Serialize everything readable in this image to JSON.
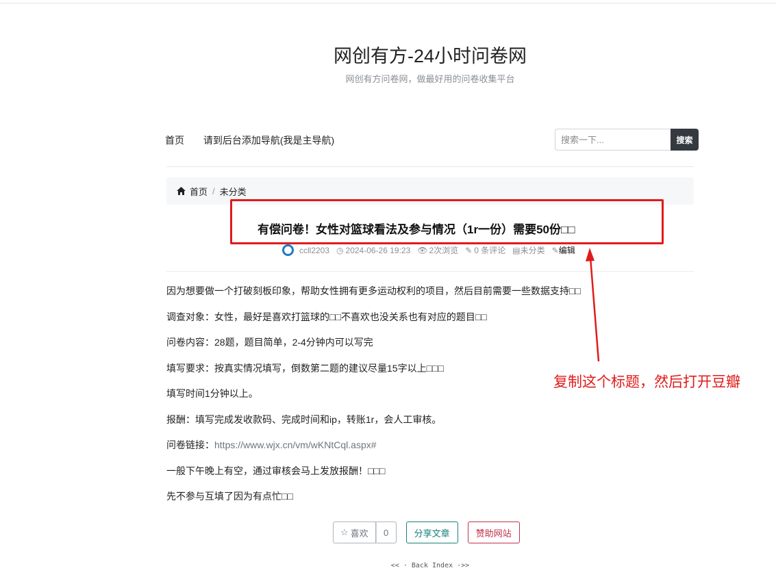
{
  "site": {
    "title": "网创有方-24小时问卷网",
    "subtitle": "网创有方问卷网，做最好用的问卷收集平台"
  },
  "nav": {
    "items": [
      "首页",
      "请到后台添加导航(我是主导航)"
    ]
  },
  "search": {
    "placeholder": "搜索一下...",
    "button_label": "搜索"
  },
  "breadcrumb": {
    "home_label": "首页",
    "separator": "/",
    "category": "未分类"
  },
  "post": {
    "title": "有偿问卷！女性对篮球看法及参与情况（1r一份）需要50份□□",
    "author": "ccll2203",
    "datetime": "2024-06-26 19:23",
    "views": "2次浏览",
    "comments": "0 条评论",
    "category": "未分类",
    "edit_label": "编辑"
  },
  "content": {
    "paragraphs": [
      "因为想要做一个打破刻板印象，帮助女性拥有更多运动权利的项目，然后目前需要一些数据支持□□",
      "调查对象：女性，最好是喜欢打篮球的□□不喜欢也没关系也有对应的题目□□",
      "问卷内容：28题，题目简单，2-4分钟内可以写完",
      "填写要求：按真实情况填写，倒数第二题的建议尽量15字以上□□□",
      "填写时间1分钟以上。",
      "报酬：填写完成发收款码、完成时间和ip，转账1r，会人工审核。"
    ],
    "link_prefix": "问卷链接：",
    "link_text": "https://www.wjx.cn/vm/wKNtCql.aspx#",
    "after": [
      "一般下午晚上有空，通过审核会马上发放报酬！□□□",
      "先不参与互填了因为有点忙□□"
    ]
  },
  "actions": {
    "like_label": "喜欢",
    "like_count": "0",
    "share_label": "分享文章",
    "donate_label": "赞助网站"
  },
  "footer": {
    "back_index": "<< · Back Index ·>>"
  },
  "annotation": {
    "text": "复制这个标题，然后打开豆瓣",
    "color": "#e11a1a"
  }
}
